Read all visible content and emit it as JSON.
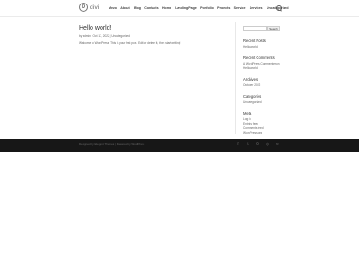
{
  "header": {
    "logo_text": "divi",
    "logo_mark": "D",
    "nav": [
      "Mezo",
      "About",
      "Blog",
      "Contacts",
      "Home",
      "Landing Page",
      "Portfolio",
      "Projects",
      "Service",
      "Services",
      "Uncategorized"
    ]
  },
  "post": {
    "title": "Hello world!",
    "meta": "by admin | Oct 17, 2022 | Uncategorized",
    "excerpt": "Welcome to WordPress. This is your first post. Edit or delete it, then start writing!"
  },
  "sidebar": {
    "search_button": "Search",
    "recent_posts": {
      "title": "Recent Posts",
      "items": [
        "Hello world!"
      ]
    },
    "recent_comments": {
      "title": "Recent Comments",
      "items": [
        "A WordPress Commenter on Hello world!"
      ]
    },
    "archives": {
      "title": "Archives",
      "items": [
        "October 2022"
      ]
    },
    "categories": {
      "title": "Categories",
      "items": [
        "Uncategorized"
      ]
    },
    "meta": {
      "title": "Meta",
      "items": [
        "Log in",
        "Entries feed",
        "Comments feed",
        "WordPress.org"
      ]
    }
  },
  "footer": {
    "credits": "Designed by Elegant Themes | Powered by WordPress",
    "social": [
      "facebook-icon",
      "twitter-icon",
      "google-plus-icon",
      "instagram-icon",
      "rss-icon"
    ]
  },
  "colors": {
    "footer_bg": "#171717",
    "header_bg": "#ffffff",
    "text": "#666666",
    "heading": "#333333"
  }
}
